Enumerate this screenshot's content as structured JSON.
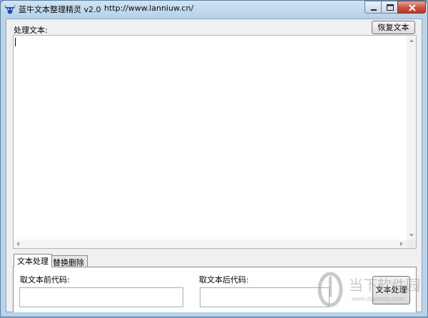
{
  "window": {
    "title": "蓝牛文本整理精灵 v2.0",
    "url": "http://www.lanniuw.cn/",
    "controls": {
      "minimize": "minimize-icon",
      "maximize": "maximize-icon",
      "close": "close-icon"
    }
  },
  "main": {
    "process_text_label": "处理文本:",
    "restore_button": "恢复文本",
    "textarea_value": ""
  },
  "tabs": [
    {
      "label": "文本处理",
      "active": true
    },
    {
      "label": "替换删除",
      "active": false
    }
  ],
  "panel": {
    "prefix_label": "取文本前代码:",
    "suffix_label": "取文本后代码:",
    "prefix_value": "",
    "suffix_value": "",
    "process_button": "文本处理"
  },
  "watermark": {
    "text": "当下软件园",
    "sub": "www.downxia.com"
  },
  "colors": {
    "accent": "#b9d3ea",
    "close": "#c7523f"
  }
}
